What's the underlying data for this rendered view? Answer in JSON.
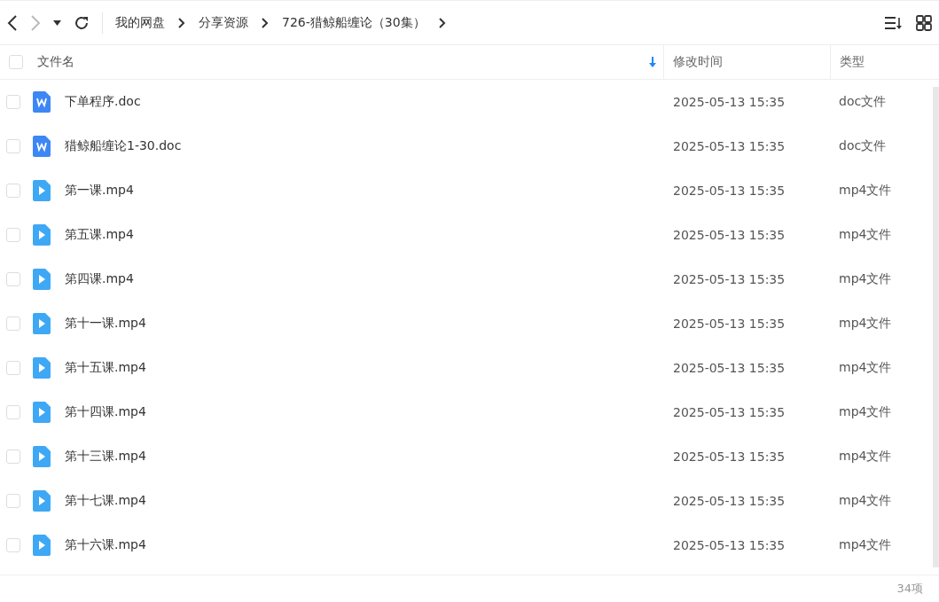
{
  "breadcrumb": [
    "我的网盘",
    "分享资源",
    "726-猎鲸船缠论（30集）"
  ],
  "columns": [
    {
      "label": "文件名",
      "sorted": true
    },
    {
      "label": "修改时间",
      "sorted": false
    },
    {
      "label": "类型",
      "sorted": false
    }
  ],
  "select_all": {
    "checked": false
  },
  "files": [
    {
      "name": "下单程序.doc",
      "kind": "doc",
      "modified": "2025-05-13 15:35",
      "type": "doc文件",
      "checked": false
    },
    {
      "name": "猎鲸船缠论1-30.doc",
      "kind": "doc",
      "modified": "2025-05-13 15:35",
      "type": "doc文件",
      "checked": false
    },
    {
      "name": "第一课.mp4",
      "kind": "video",
      "modified": "2025-05-13 15:35",
      "type": "mp4文件",
      "checked": false
    },
    {
      "name": "第五课.mp4",
      "kind": "video",
      "modified": "2025-05-13 15:35",
      "type": "mp4文件",
      "checked": false
    },
    {
      "name": "第四课.mp4",
      "kind": "video",
      "modified": "2025-05-13 15:35",
      "type": "mp4文件",
      "checked": false
    },
    {
      "name": "第十一课.mp4",
      "kind": "video",
      "modified": "2025-05-13 15:35",
      "type": "mp4文件",
      "checked": false
    },
    {
      "name": "第十五课.mp4",
      "kind": "video",
      "modified": "2025-05-13 15:35",
      "type": "mp4文件",
      "checked": false
    },
    {
      "name": "第十四课.mp4",
      "kind": "video",
      "modified": "2025-05-13 15:35",
      "type": "mp4文件",
      "checked": false
    },
    {
      "name": "第十三课.mp4",
      "kind": "video",
      "modified": "2025-05-13 15:35",
      "type": "mp4文件",
      "checked": false
    },
    {
      "name": "第十七课.mp4",
      "kind": "video",
      "modified": "2025-05-13 15:35",
      "type": "mp4文件",
      "checked": false
    },
    {
      "name": "第十六课.mp4",
      "kind": "video",
      "modified": "2025-05-13 15:35",
      "type": "mp4文件",
      "checked": false
    }
  ],
  "status_bar": {
    "count": "34项"
  }
}
